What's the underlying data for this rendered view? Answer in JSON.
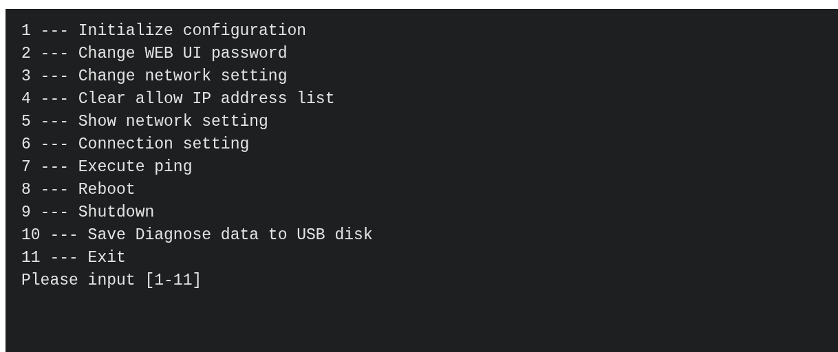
{
  "terminal": {
    "menu_options": [
      "1 --- Initialize configuration",
      "2 --- Change WEB UI password",
      "3 --- Change network setting",
      "4 --- Clear allow IP address list",
      "5 --- Show network setting",
      "6 --- Connection setting",
      "7 --- Execute ping",
      "8 --- Reboot",
      "9 --- Shutdown",
      "10 --- Save Diagnose data to USB disk",
      "11 --- Exit"
    ],
    "prompt": "Please input [1-11]"
  }
}
